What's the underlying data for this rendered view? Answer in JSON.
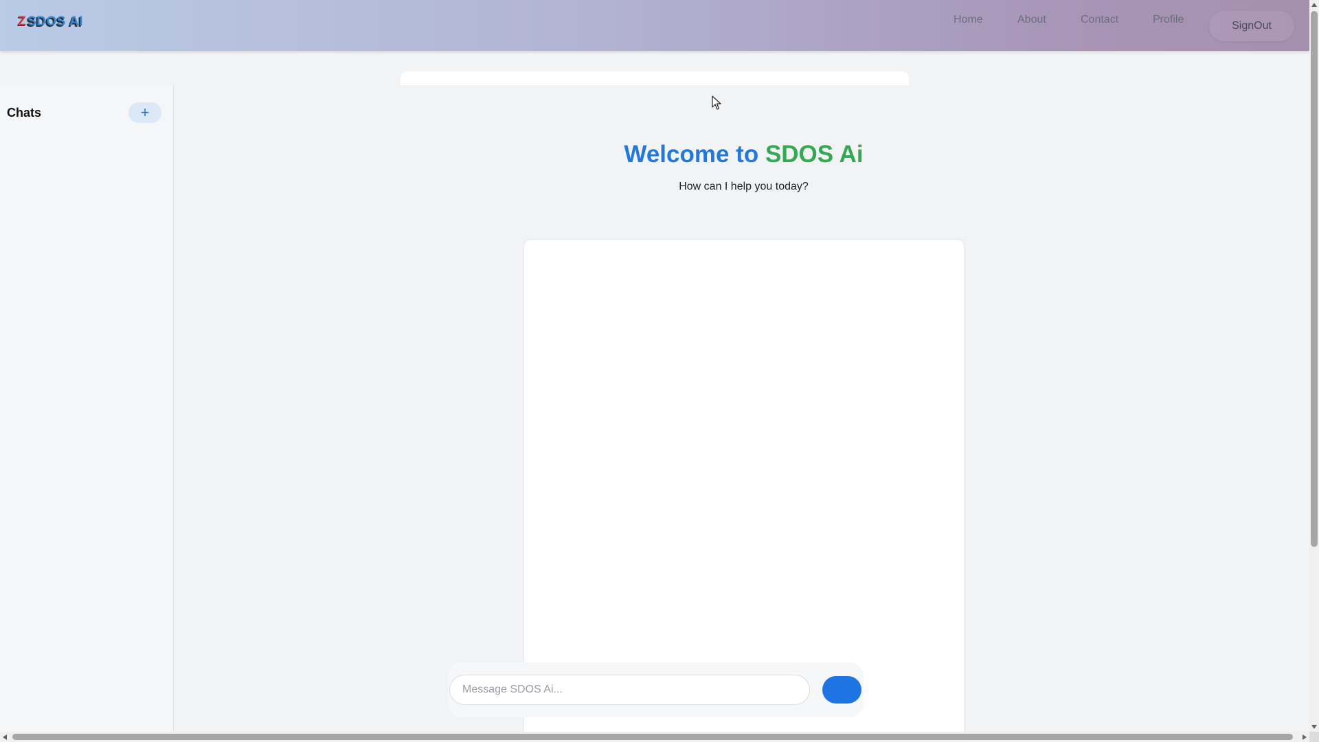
{
  "app": {
    "logo_mark": "Z",
    "logo_text": "SDOS AI"
  },
  "nav": {
    "home": "Home",
    "about": "About",
    "contact": "Contact",
    "profile": "Profile",
    "signout": "SignOut"
  },
  "sidebar": {
    "title": "Chats",
    "new_chat_label": "+"
  },
  "main": {
    "welcome_part1": "Welcome to ",
    "welcome_part2": "SDOS Ai",
    "subtitle": "How can I help you today?"
  },
  "composer": {
    "placeholder": "Message SDOS Ai...",
    "value": ""
  },
  "colors": {
    "accent_blue": "#2378d8",
    "accent_green": "#35a853",
    "send_button": "#1f74e3",
    "logo_red": "#d8343a"
  },
  "icons": {
    "new_chat": "plus-icon",
    "cursor": "mouse-pointer-icon"
  }
}
